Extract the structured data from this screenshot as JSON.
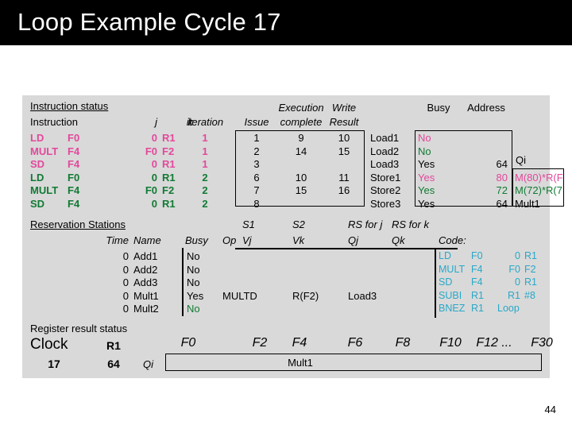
{
  "slide": {
    "title": "Loop Example Cycle 17",
    "page_number": "44"
  },
  "colors": {
    "iteration1": "#e3489c",
    "iteration2": "#117a33",
    "code": "#28a8c8",
    "panel_bg": "#d9d9d9",
    "title_bg": "#000000"
  },
  "instruction_status": {
    "section_label": "Instruction status",
    "headers": {
      "instruction": "Instruction",
      "j": "j",
      "k": "k",
      "iteration": "iteration",
      "issue": "Issue",
      "exec_line1": "Execution",
      "exec_line2": "complete",
      "write_line1": "Write",
      "write_line2": "Result"
    },
    "rows": [
      {
        "op": "LD",
        "dest": "F0",
        "j": "0",
        "k": "R1",
        "iteration": "1",
        "issue": "1",
        "exec": "9",
        "write": "10",
        "color": "iteration1"
      },
      {
        "op": "MULT",
        "dest": "F4",
        "j": "F0",
        "k": "F2",
        "iteration": "1",
        "issue": "2",
        "exec": "14",
        "write": "15",
        "color": "iteration1"
      },
      {
        "op": "SD",
        "dest": "F4",
        "j": "0",
        "k": "R1",
        "iteration": "1",
        "issue": "3",
        "exec": "",
        "write": "",
        "color": "iteration1"
      },
      {
        "op": "LD",
        "dest": "F0",
        "j": "0",
        "k": "R1",
        "iteration": "2",
        "issue": "6",
        "exec": "10",
        "write": "11",
        "color": "iteration2"
      },
      {
        "op": "MULT",
        "dest": "F4",
        "j": "F0",
        "k": "F2",
        "iteration": "2",
        "issue": "7",
        "exec": "15",
        "write": "16",
        "color": "iteration2"
      },
      {
        "op": "SD",
        "dest": "F4",
        "j": "0",
        "k": "R1",
        "iteration": "2",
        "issue": "8",
        "exec": "",
        "write": "",
        "color": "iteration2"
      }
    ]
  },
  "memory_units": {
    "headers": {
      "busy": "Busy",
      "address": "Address",
      "qi": "Qi"
    },
    "rows": [
      {
        "name": "Load1",
        "busy": "No",
        "address": "",
        "qi": "",
        "color": "iteration1"
      },
      {
        "name": "Load2",
        "busy": "No",
        "address": "",
        "qi": "",
        "color": "iteration2"
      },
      {
        "name": "Load3",
        "busy": "Yes",
        "address": "64",
        "qi": "",
        "color": "black"
      },
      {
        "name": "Store1",
        "busy": "Yes",
        "address": "80",
        "qi": "M(80)*R(F",
        "color": "iteration1"
      },
      {
        "name": "Store2",
        "busy": "Yes",
        "address": "72",
        "qi": "M(72)*R(7",
        "color": "iteration2"
      },
      {
        "name": "Store3",
        "busy": "Yes",
        "address": "64",
        "qi": "Mult1",
        "color": "black"
      }
    ]
  },
  "reservation_stations": {
    "section_label": "Reservation Stations",
    "headers": {
      "time": "Time",
      "name": "Name",
      "busy": "Busy",
      "op": "Op",
      "s1": "S1",
      "s2": "S2",
      "rs_for_j": "RS for j",
      "rs_for_k": "RS for k",
      "vj": "Vj",
      "vk": "Vk",
      "qj": "Qj",
      "qk": "Qk"
    },
    "rows": [
      {
        "time": "0",
        "name": "Add1",
        "busy": "No",
        "op": "",
        "vj": "",
        "vk": "",
        "qj": "",
        "qk": "",
        "busy_color": "black"
      },
      {
        "time": "0",
        "name": "Add2",
        "busy": "No",
        "op": "",
        "vj": "",
        "vk": "",
        "qj": "",
        "qk": "",
        "busy_color": "black"
      },
      {
        "time": "0",
        "name": "Add3",
        "busy": "No",
        "op": "",
        "vj": "",
        "vk": "",
        "qj": "",
        "qk": "",
        "busy_color": "black"
      },
      {
        "time": "0",
        "name": "Mult1",
        "busy": "Yes",
        "op": "MULTD",
        "vj": "",
        "vk": "R(F2)",
        "qj": "Load3",
        "qk": "",
        "busy_color": "black"
      },
      {
        "time": "0",
        "name": "Mult2",
        "busy": "No",
        "op": "",
        "vj": "",
        "vk": "",
        "qj": "",
        "qk": "",
        "busy_color": "iteration2"
      }
    ]
  },
  "code": {
    "label": "Code:",
    "lines": [
      {
        "op": "LD",
        "a": "F0",
        "b": "0",
        "c": "R1"
      },
      {
        "op": "MULT",
        "a": "F4",
        "b": "F0",
        "c": "F2"
      },
      {
        "op": "SD",
        "a": "F4",
        "b": "0",
        "c": "R1"
      },
      {
        "op": "SUBI",
        "a": "R1",
        "b": "R1",
        "c": "#8"
      },
      {
        "op": "BNEZ",
        "a": "R1",
        "b": "Loop",
        "c": ""
      }
    ]
  },
  "register_result_status": {
    "section_label": "Register result status",
    "clock_label": "Clock",
    "clock_value": "17",
    "r1_label": "R1",
    "r1_value": "64",
    "qi_label": "Qi",
    "registers": [
      "F0",
      "F2",
      "F4",
      "F6",
      "F8",
      "F10",
      "F12 ...",
      "F30"
    ],
    "values": {
      "F4": "Mult1"
    }
  }
}
